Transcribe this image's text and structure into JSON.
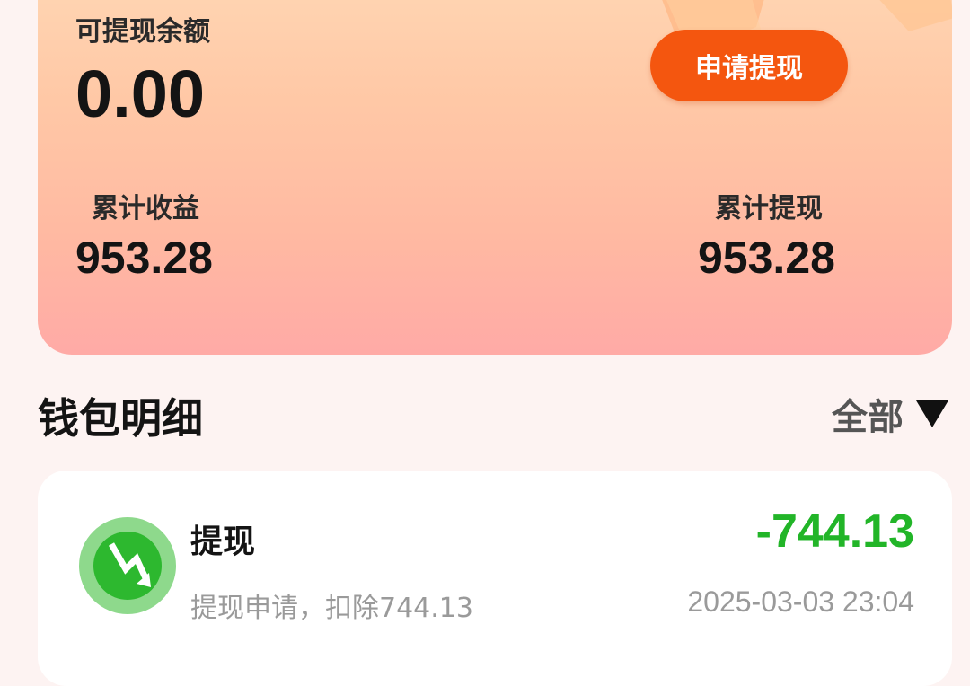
{
  "wallet": {
    "available_label": "可提现余额",
    "available_amount": "0.00",
    "withdraw_button": "申请提现",
    "total_income_label": "累计收益",
    "total_income_value": "953.28",
    "total_withdrawn_label": "累计提现",
    "total_withdrawn_value": "953.28"
  },
  "details": {
    "title": "钱包明细",
    "filter_label": "全部",
    "filter_icon": "triangle-down-icon"
  },
  "records": [
    {
      "title": "提现",
      "description": "提现申请，扣除744.13",
      "amount": "-744.13",
      "time": "2025-03-03 23:04",
      "icon": "withdraw-arrow-icon",
      "amount_color": "#22b528"
    }
  ],
  "colors": {
    "accent": "#f4560f",
    "card_gradient_top": "#ffd7b4",
    "card_gradient_bottom": "#ffaaa6",
    "positive_green": "#22b528",
    "icon_green": "#2db82f"
  }
}
